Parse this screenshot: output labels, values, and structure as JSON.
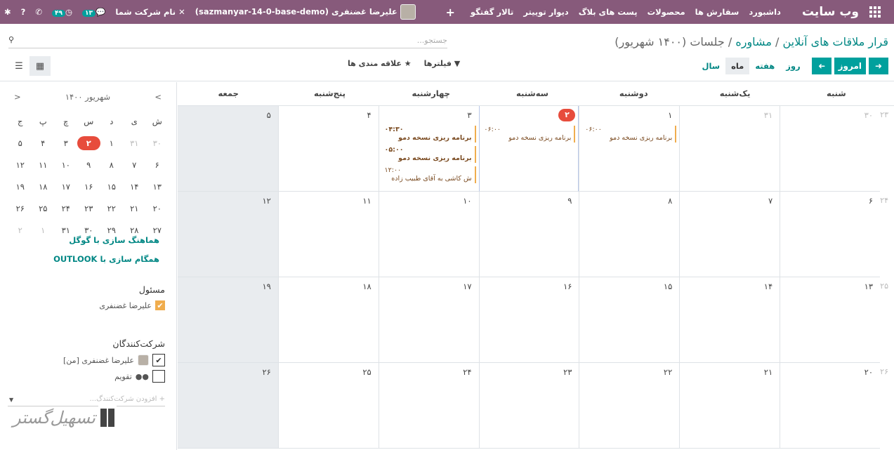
{
  "topbar": {
    "brand": "وب سایت",
    "menu": [
      "داشبورد",
      "سفارش ها",
      "محصولات",
      "پست های بلاگ",
      "دیوار توییتر",
      "تالار گفتگو"
    ],
    "user": "علیرضا غضنفری (sazmanyar-14-0-base-demo)",
    "company": "نام شرکت شما",
    "chat_count": "۱۳",
    "activity_count": "۴۹"
  },
  "breadcrumb": {
    "root": "قرار ملاقات های آنلاین",
    "sep": "/",
    "mid": "مشاوره",
    "current": "جلسات (۱۴۰۰ شهریور)"
  },
  "search": {
    "placeholder": "جستجو..."
  },
  "buttons": {
    "today": "امروز",
    "day": "روز",
    "week": "هفته",
    "month": "ماه",
    "year": "سال"
  },
  "filters": {
    "filters_label": "فیلترها",
    "favorites_label": "علاقه مندی ها"
  },
  "mini_calendar": {
    "title": "شهریور ۱۴۰۰",
    "headers": [
      "ش",
      "ی",
      "د",
      "س",
      "چ",
      "پ",
      "ج"
    ],
    "rows": [
      [
        {
          "d": "۳۰",
          "dim": true
        },
        {
          "d": "۳۱",
          "dim": true
        },
        {
          "d": "۱"
        },
        {
          "d": "۲",
          "today": true
        },
        {
          "d": "۳"
        },
        {
          "d": "۴"
        },
        {
          "d": "۵"
        }
      ],
      [
        {
          "d": "۶"
        },
        {
          "d": "۷"
        },
        {
          "d": "۸"
        },
        {
          "d": "۹"
        },
        {
          "d": "۱۰"
        },
        {
          "d": "۱۱"
        },
        {
          "d": "۱۲"
        }
      ],
      [
        {
          "d": "۱۳"
        },
        {
          "d": "۱۴"
        },
        {
          "d": "۱۵"
        },
        {
          "d": "۱۶"
        },
        {
          "d": "۱۷"
        },
        {
          "d": "۱۸"
        },
        {
          "d": "۱۹"
        }
      ],
      [
        {
          "d": "۲۰"
        },
        {
          "d": "۲۱"
        },
        {
          "d": "۲۲"
        },
        {
          "d": "۲۳"
        },
        {
          "d": "۲۴"
        },
        {
          "d": "۲۵"
        },
        {
          "d": "۲۶"
        }
      ],
      [
        {
          "d": "۲۷"
        },
        {
          "d": "۲۸"
        },
        {
          "d": "۲۹"
        },
        {
          "d": "۳۰"
        },
        {
          "d": "۳۱"
        },
        {
          "d": "۱",
          "dim": true
        },
        {
          "d": "۲",
          "dim": true
        }
      ]
    ]
  },
  "sync": {
    "google": "هماهنگ سازی با گوگل",
    "outlook": "همگام سازی با OUTLOOK"
  },
  "responsible": {
    "title": "مسئول",
    "user": "علیرضا غضنفری"
  },
  "attendees": {
    "title": "شرکت‌کنندگان",
    "me": "علیرضا غضنفری [من]",
    "calendar": "تقویم",
    "add_placeholder": "+ افزودن شرکت‌کنندگ..."
  },
  "watermark": "تسهیل‌گستر",
  "calendar": {
    "weekdays": [
      "شنبه",
      "یک‌شنبه",
      "دوشنبه",
      "سه‌شنبه",
      "چهارشنبه",
      "پنج‌شنبه",
      "جمعه"
    ],
    "weeks": [
      {
        "wk": "۲۳",
        "days": [
          {
            "d": "۳۰",
            "dim": true
          },
          {
            "d": "۳۱",
            "dim": true
          },
          {
            "d": "۱"
          },
          {
            "d": "۲",
            "today": true
          },
          {
            "d": "۳"
          },
          {
            "d": "۴"
          },
          {
            "d": "۵"
          }
        ]
      },
      {
        "wk": "۲۴",
        "days": [
          {
            "d": "۶"
          },
          {
            "d": "۷"
          },
          {
            "d": "۸"
          },
          {
            "d": "۹"
          },
          {
            "d": "۱۰"
          },
          {
            "d": "۱۱"
          },
          {
            "d": "۱۲"
          }
        ]
      },
      {
        "wk": "۲۵",
        "days": [
          {
            "d": "۱۳"
          },
          {
            "d": "۱۴"
          },
          {
            "d": "۱۵"
          },
          {
            "d": "۱۶"
          },
          {
            "d": "۱۷"
          },
          {
            "d": "۱۸"
          },
          {
            "d": "۱۹"
          }
        ]
      },
      {
        "wk": "۲۶",
        "days": [
          {
            "d": "۲۰"
          },
          {
            "d": "۲۱"
          },
          {
            "d": "۲۲"
          },
          {
            "d": "۲۳"
          },
          {
            "d": "۲۴"
          },
          {
            "d": "۲۵"
          },
          {
            "d": "۲۶"
          }
        ]
      }
    ],
    "events": [
      {
        "day": "1",
        "time": "۰۶:۰۰",
        "title": "برنامه ریزی نسخه دمو",
        "bold": false
      },
      {
        "day": "2",
        "time": "۰۶:۰۰",
        "title": "برنامه ریزی نسخه دمو",
        "bold": false
      },
      {
        "day": "3",
        "time": "۰۴:۳۰",
        "title": "برنامه ریزی نسخه دمو",
        "bold": true
      },
      {
        "day": "3",
        "time": "۰۵:۰۰",
        "title": "برنامه ریزی نسخه دمو",
        "bold": true
      },
      {
        "day": "3",
        "time": "۱۲:۰۰",
        "title": "ش کاشی به آقای طبیب زاده",
        "bold": false
      }
    ]
  },
  "colors": {
    "primary": "#875a7b",
    "accent": "#00a09d",
    "today": "#e74c3c",
    "event": "#f0ad4e"
  }
}
